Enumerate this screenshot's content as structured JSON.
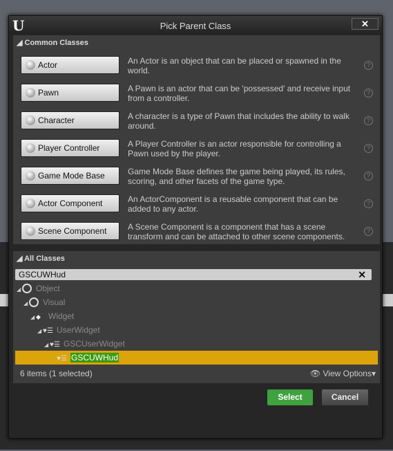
{
  "dialog": {
    "title": "Pick Parent Class",
    "close_label": "✕"
  },
  "common": {
    "header": "Common Classes",
    "items": [
      {
        "label": "Actor",
        "desc": "An Actor is an object that can be placed or spawned in the world."
      },
      {
        "label": "Pawn",
        "desc": "A Pawn is an actor that can be 'possessed' and receive input from a controller."
      },
      {
        "label": "Character",
        "desc": "A character is a type of Pawn that includes the ability to walk around."
      },
      {
        "label": "Player Controller",
        "desc": "A Player Controller is an actor responsible for controlling a Pawn used by the player."
      },
      {
        "label": "Game Mode Base",
        "desc": "Game Mode Base defines the game being played, its rules, scoring, and other facets of the game type."
      },
      {
        "label": "Actor Component",
        "desc": "An ActorComponent is a reusable component that can be added to any actor."
      },
      {
        "label": "Scene Component",
        "desc": "A Scene Component is a component that has a scene transform and can be attached to other scene components."
      }
    ],
    "help": "?"
  },
  "all": {
    "header": "All Classes",
    "search_value": "GSCUWHud",
    "tree": [
      {
        "label": "Object"
      },
      {
        "label": "Visual"
      },
      {
        "label": "Widget"
      },
      {
        "label": "UserWidget"
      },
      {
        "label": "GSCUserWidget"
      },
      {
        "label": "GSCUWHud"
      }
    ],
    "status": "6 items (1 selected)",
    "view_options": "View Options"
  },
  "footer": {
    "select": "Select",
    "cancel": "Cancel"
  },
  "colors": {
    "selection": "#dba40a",
    "select_button": "#3fa13f"
  }
}
